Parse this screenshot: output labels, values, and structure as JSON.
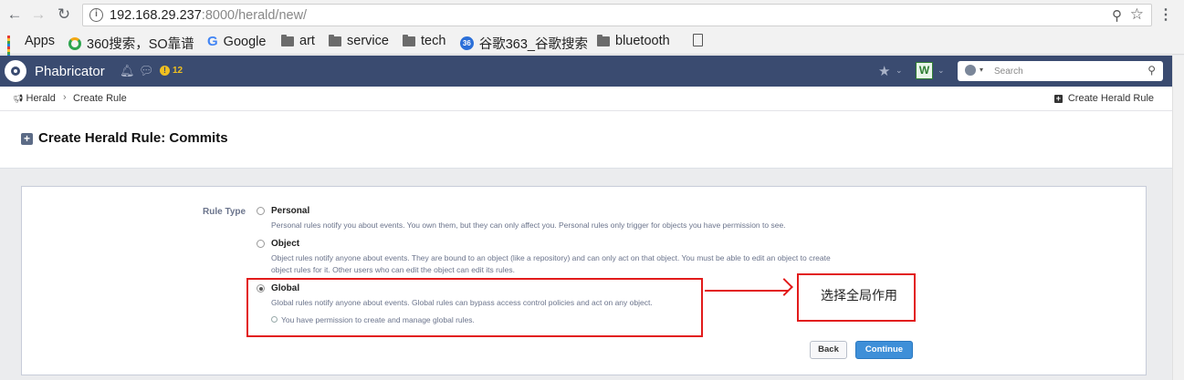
{
  "browser": {
    "url_host": "192.168.29.237",
    "url_path": ":8000/herald/new/",
    "bookmarks": {
      "apps": "Apps",
      "so360": "360搜索，SO靠谱",
      "google": "Google",
      "art": "art",
      "service": "service",
      "tech": "tech",
      "gugexiang": "谷歌363_谷歌搜索",
      "bluetooth": "bluetooth"
    }
  },
  "header": {
    "app_name": "Phabricator",
    "notification_count": "12",
    "user_initial": "W",
    "search_placeholder": "Search"
  },
  "crumbs": {
    "herald": "Herald",
    "create_rule": "Create Rule",
    "action": "Create Herald Rule"
  },
  "page": {
    "title": "Create Herald Rule: Commits"
  },
  "form": {
    "rule_type_label": "Rule Type",
    "selected": "global",
    "options": {
      "personal": {
        "title": "Personal",
        "desc": "Personal rules notify you about events. You own them, but they can only affect you. Personal rules only trigger for objects you have permission to see."
      },
      "object": {
        "title": "Object",
        "desc1": "Object rules notify anyone about events. They are bound to an object (like a repository) and can only act on that object. You must be able to edit an object to create",
        "desc2": "object rules for it. Other users who can edit the object can edit its rules."
      },
      "global": {
        "title": "Global",
        "desc": "Global rules notify anyone about events. Global rules can bypass access control policies and act on any object.",
        "permission": "You have permission to create and manage global rules."
      }
    },
    "back_label": "Back",
    "continue_label": "Continue"
  },
  "annotation": {
    "note": "选择全局作用"
  },
  "colors": {
    "header_bg": "#3a4b70",
    "continue_bg": "#3e8fd8",
    "annotation_red": "#e21b1b"
  }
}
